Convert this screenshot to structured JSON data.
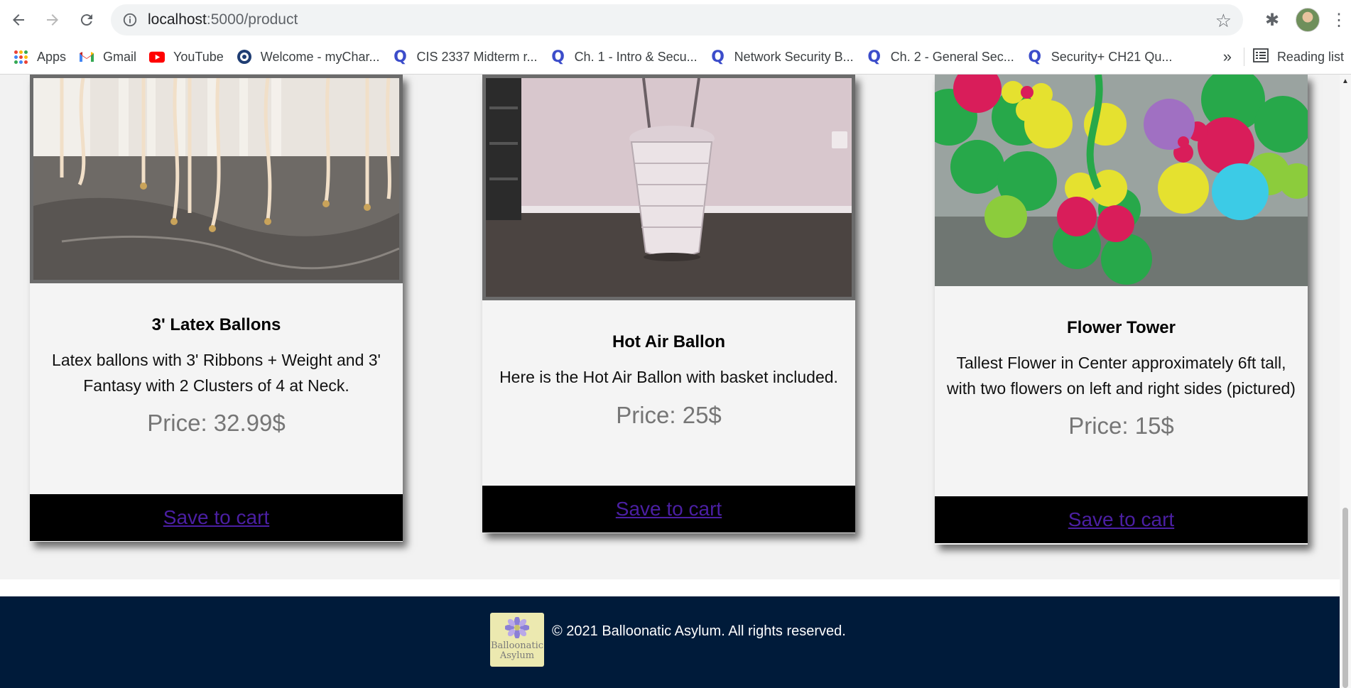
{
  "browser": {
    "url_host": "localhost",
    "url_path": ":5000/product",
    "bookmarks": [
      {
        "label": "Apps",
        "icon": "apps-icon"
      },
      {
        "label": "Gmail",
        "icon": "gmail-icon"
      },
      {
        "label": "YouTube",
        "icon": "youtube-icon"
      },
      {
        "label": "Welcome - myChar...",
        "icon": "charter-icon"
      },
      {
        "label": "CIS 2337 Midterm r...",
        "icon": "quizlet-icon"
      },
      {
        "label": "Ch. 1 - Intro & Secu...",
        "icon": "quizlet-icon"
      },
      {
        "label": "Network Security B...",
        "icon": "quizlet-icon"
      },
      {
        "label": "Ch. 2 - General Sec...",
        "icon": "quizlet-icon"
      },
      {
        "label": "Security+ CH21 Qu...",
        "icon": "quizlet-icon"
      }
    ],
    "more_label": "»",
    "reading_list": "Reading list"
  },
  "products": [
    {
      "title": "3' Latex Ballons",
      "description": "Latex ballons with 3' Ribbons + Weight and 3' Fantasy with 2 Clusters of 4 at Neck.",
      "price": "Price: 32.99$",
      "cart_label": "Save to cart"
    },
    {
      "title": "Hot Air Ballon",
      "description": "Here is the Hot Air Ballon with basket included.",
      "price": "Price: 25$",
      "cart_label": "Save to cart"
    },
    {
      "title": "Flower Tower",
      "description": "Tallest Flower in Center approximately 6ft tall, with two flowers on left and right sides (pictured)",
      "price": "Price: 15$",
      "cart_label": "Save to cart"
    }
  ],
  "footer": {
    "logo_line1": "Balloonatic",
    "logo_line2": "Asylum",
    "copyright": "© 2021 Balloonatic Asylum. All rights reserved."
  },
  "colors": {
    "footer_bg": "#001b3a",
    "cart_bar_bg": "#000000",
    "cart_link": "#4b1fa3",
    "price_text": "#767676"
  }
}
